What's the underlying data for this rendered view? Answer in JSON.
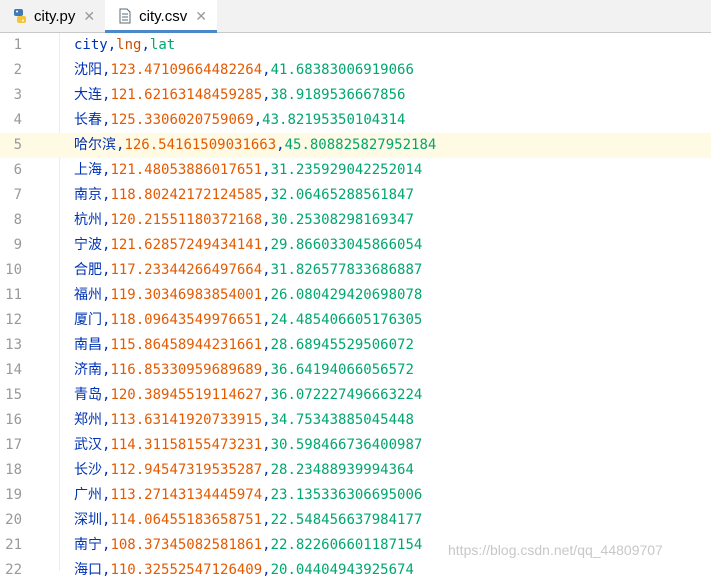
{
  "tabs": [
    {
      "label": "city.py",
      "active": false,
      "icon": "python-file-icon"
    },
    {
      "label": "city.csv",
      "active": true,
      "icon": "csv-file-icon"
    }
  ],
  "editor": {
    "header": {
      "line": "1",
      "fields": [
        "city",
        "lng",
        "lat"
      ]
    },
    "current_line": 5,
    "rows": [
      {
        "line": "2",
        "city": "沈阳",
        "lng": "123.47109664482264",
        "lat": "41.68383006919066"
      },
      {
        "line": "3",
        "city": "大连",
        "lng": "121.62163148459285",
        "lat": "38.9189536667856"
      },
      {
        "line": "4",
        "city": "长春",
        "lng": "125.3306020759069",
        "lat": "43.82195350104314"
      },
      {
        "line": "5",
        "city": "哈尔滨",
        "lng": "126.54161509031663",
        "lat": "45.808825827952184"
      },
      {
        "line": "6",
        "city": "上海",
        "lng": "121.48053886017651",
        "lat": "31.235929042252014"
      },
      {
        "line": "7",
        "city": "南京",
        "lng": "118.80242172124585",
        "lat": "32.06465288561847"
      },
      {
        "line": "8",
        "city": "杭州",
        "lng": "120.21551180372168",
        "lat": "30.25308298169347"
      },
      {
        "line": "9",
        "city": "宁波",
        "lng": "121.62857249434141",
        "lat": "29.866033045866054"
      },
      {
        "line": "10",
        "city": "合肥",
        "lng": "117.23344266497664",
        "lat": "31.826577833686887"
      },
      {
        "line": "11",
        "city": "福州",
        "lng": "119.30346983854001",
        "lat": "26.080429420698078"
      },
      {
        "line": "12",
        "city": "厦门",
        "lng": "118.09643549976651",
        "lat": "24.485406605176305"
      },
      {
        "line": "13",
        "city": "南昌",
        "lng": "115.86458944231661",
        "lat": "28.68945529506072"
      },
      {
        "line": "14",
        "city": "济南",
        "lng": "116.85330959689689",
        "lat": "36.64194066056572"
      },
      {
        "line": "15",
        "city": "青岛",
        "lng": "120.38945519114627",
        "lat": "36.072227496663224"
      },
      {
        "line": "16",
        "city": "郑州",
        "lng": "113.63141920733915",
        "lat": "34.75343885045448"
      },
      {
        "line": "17",
        "city": "武汉",
        "lng": "114.31158155473231",
        "lat": "30.598466736400987"
      },
      {
        "line": "18",
        "city": "长沙",
        "lng": "112.94547319535287",
        "lat": "28.23488939994364"
      },
      {
        "line": "19",
        "city": "广州",
        "lng": "113.27143134445974",
        "lat": "23.135336306695006"
      },
      {
        "line": "20",
        "city": "深圳",
        "lng": "114.06455183658751",
        "lat": "22.548456637984177"
      },
      {
        "line": "21",
        "city": "南宁",
        "lng": "108.37345082581861",
        "lat": "22.822606601187154"
      },
      {
        "line": "22",
        "city": "海口",
        "lng": "110.32552547126409",
        "lat": "20.04404943925674"
      }
    ]
  },
  "watermark": "https://blog.csdn.net/qq_44809707",
  "colors": {
    "city": "#0033b3",
    "lng": "#e45a00",
    "lat": "#00a76f",
    "current_line_bg": "#fffae3",
    "tab_underline": "#4a88c7"
  }
}
